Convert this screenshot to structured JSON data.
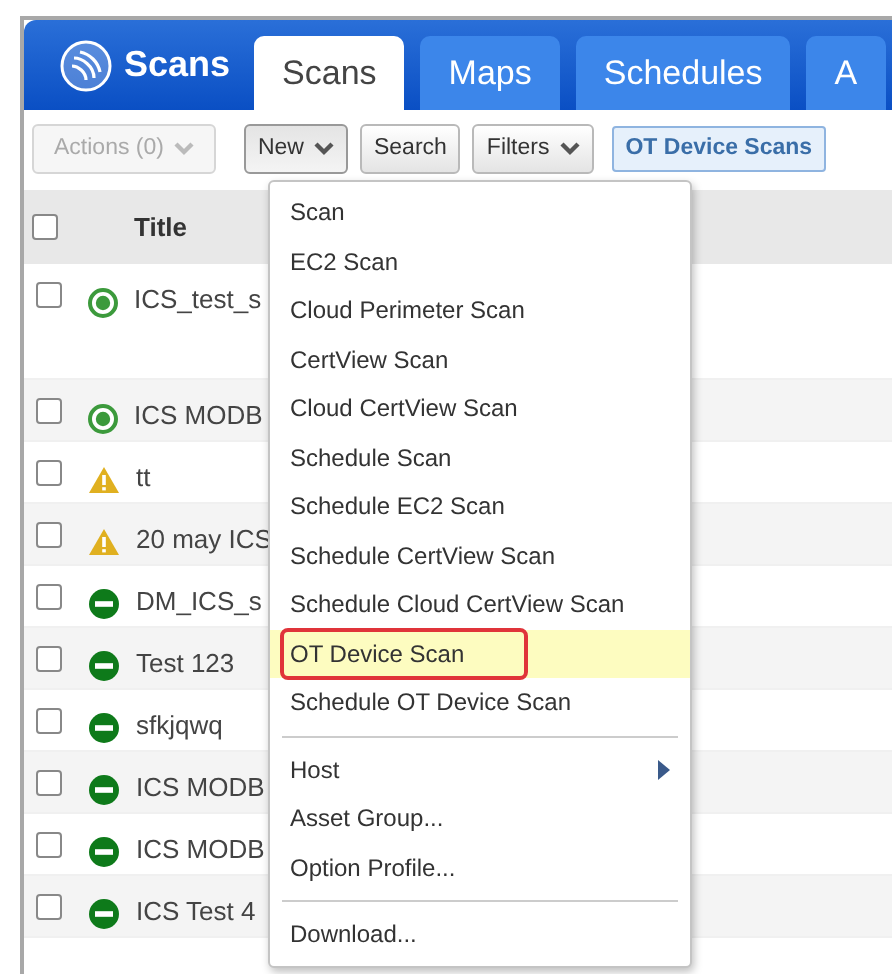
{
  "app": {
    "title": "Scans"
  },
  "tabs": [
    {
      "label": "Scans",
      "selected": true
    },
    {
      "label": "Maps",
      "selected": false
    },
    {
      "label": "Schedules",
      "selected": false
    },
    {
      "label": "A",
      "selected": false
    }
  ],
  "toolbar": {
    "actions": {
      "label": "Actions (0)",
      "disabled": true
    },
    "new": {
      "label": "New",
      "expanded": true
    },
    "search": {
      "label": "Search"
    },
    "filters": {
      "label": "Filters"
    },
    "filter_tag": "OT Device Scans"
  },
  "table": {
    "all_checked": false,
    "columns": [
      "Title"
    ],
    "rows": [
      {
        "title": "ICS_test_s",
        "kind": "finished",
        "checked": false,
        "tall": true
      },
      {
        "title": "ICS MODB",
        "kind": "finished",
        "checked": false
      },
      {
        "title": "tt",
        "kind": "warning",
        "checked": false
      },
      {
        "title": "20 may ICS",
        "kind": "warning",
        "checked": false
      },
      {
        "title": "DM_ICS_s",
        "kind": "canceled",
        "checked": false
      },
      {
        "title": "Test 123",
        "kind": "canceled",
        "checked": false
      },
      {
        "title": "sfkjqwq",
        "kind": "canceled",
        "checked": false
      },
      {
        "title": "ICS MODB",
        "kind": "canceled",
        "checked": false
      },
      {
        "title": "ICS MODB",
        "kind": "canceled",
        "checked": false
      },
      {
        "title": "ICS Test 4",
        "kind": "canceled",
        "checked": false
      }
    ]
  },
  "new_menu": {
    "groups": [
      [
        {
          "label": "Scan",
          "selected": false
        },
        {
          "label": "EC2 Scan",
          "selected": false
        },
        {
          "label": "Cloud Perimeter Scan",
          "selected": false
        },
        {
          "label": "CertView Scan",
          "selected": false
        },
        {
          "label": "Cloud CertView Scan",
          "selected": false
        },
        {
          "label": "Schedule Scan",
          "selected": false
        },
        {
          "label": "Schedule EC2 Scan",
          "selected": false
        },
        {
          "label": "Schedule CertView Scan",
          "selected": false
        },
        {
          "label": "Schedule Cloud CertView Scan",
          "selected": false
        },
        {
          "label": "OT Device Scan",
          "selected": true
        },
        {
          "label": "Schedule OT Device Scan",
          "selected": false
        }
      ],
      [
        {
          "label": "Host",
          "selected": false,
          "submenu": true
        },
        {
          "label": "Asset Group...",
          "selected": false
        },
        {
          "label": "Option Profile...",
          "selected": false
        }
      ],
      [
        {
          "label": "Download...",
          "selected": false
        }
      ]
    ]
  }
}
